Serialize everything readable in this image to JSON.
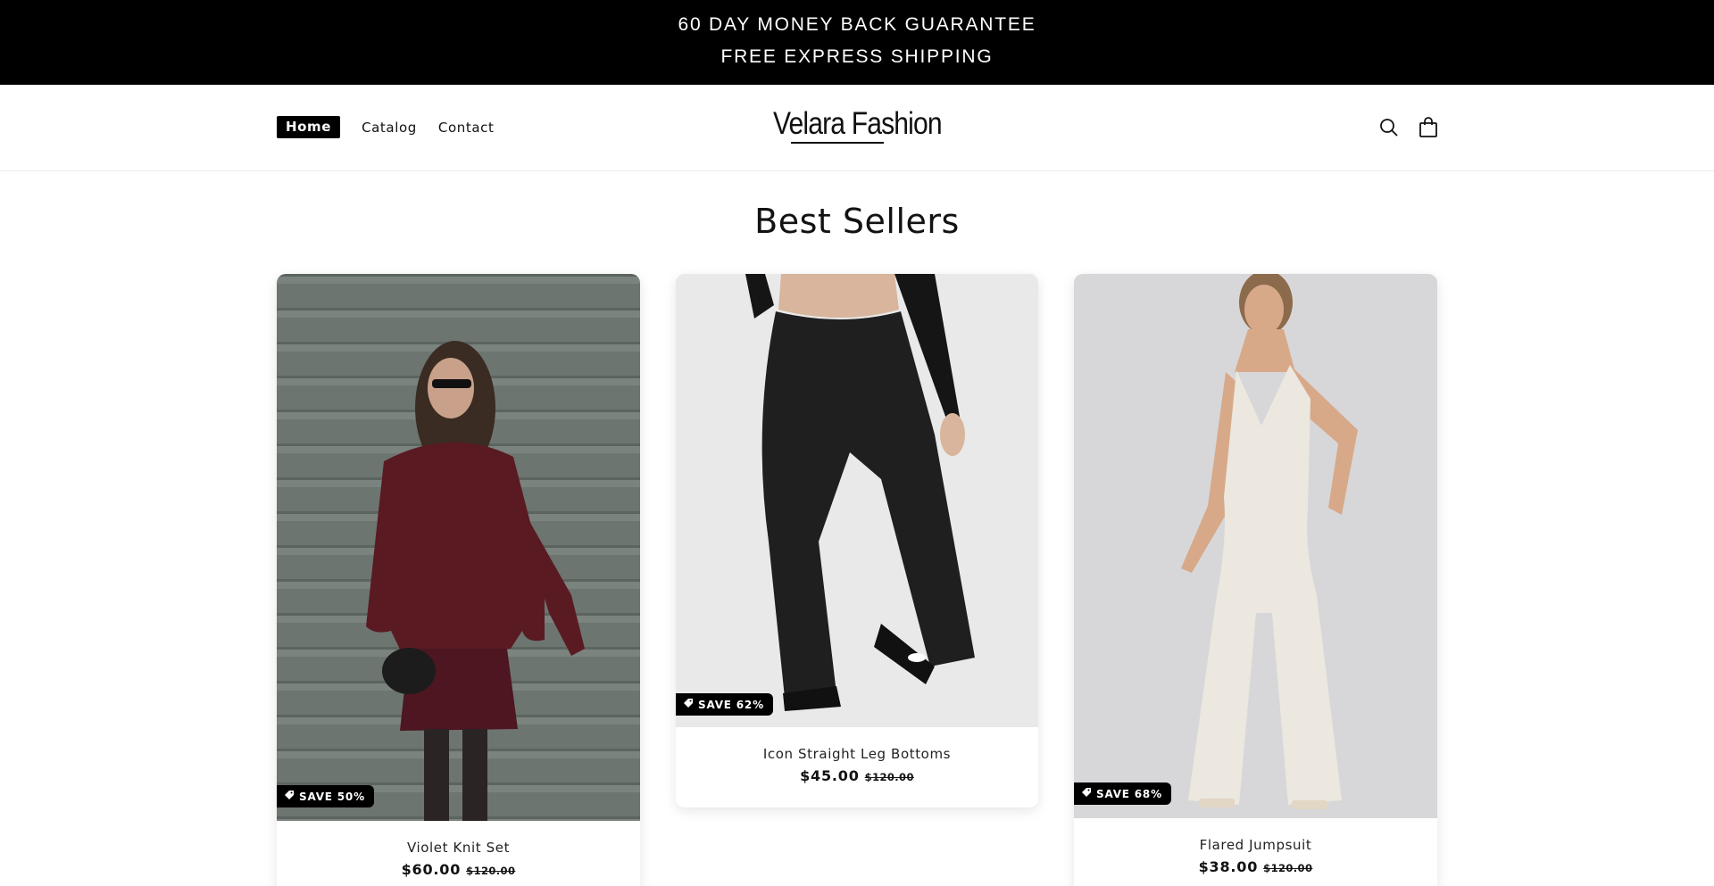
{
  "announcement": {
    "line1": "60 DAY MONEY BACK GUARANTEE",
    "line2": "FREE EXPRESS SHIPPING"
  },
  "header": {
    "nav": [
      {
        "label": "Home",
        "active": true
      },
      {
        "label": "Catalog",
        "active": false
      },
      {
        "label": "Contact",
        "active": false
      }
    ],
    "logo_text": "Velara Fashion",
    "icons": [
      "search-icon",
      "cart-icon"
    ]
  },
  "section": {
    "title": "Best Sellers"
  },
  "products": [
    {
      "name": "Violet Knit Set",
      "price": "$60.00",
      "compare_price": "$120.00",
      "badge": "SAVE 50%"
    },
    {
      "name": "Icon Straight Leg Bottoms",
      "price": "$45.00",
      "compare_price": "$120.00",
      "badge": "SAVE 62%"
    },
    {
      "name": "Flared Jumpsuit",
      "price": "$38.00",
      "compare_price": "$120.00",
      "badge": "SAVE 68%"
    }
  ],
  "colors": {
    "announcement_bg": "#000000",
    "text": "#121212",
    "badge_bg": "#000000"
  }
}
